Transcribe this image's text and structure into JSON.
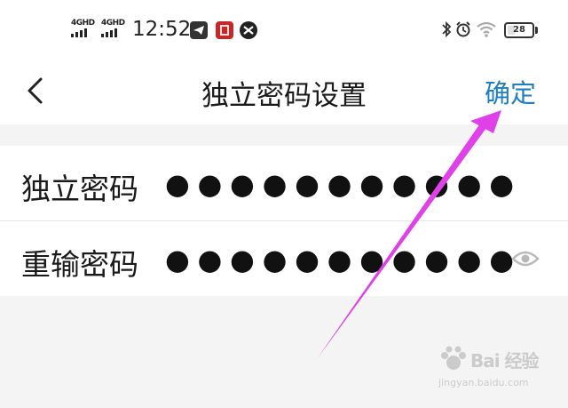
{
  "status_bar": {
    "sim1_label": "4GHD",
    "sim2_label": "4GHD",
    "time": "12:52",
    "battery_level": "28",
    "icons": [
      "telegram-icon",
      "red-app-icon",
      "capcut-icon",
      "bluetooth-icon",
      "alarm-icon",
      "wifi-icon",
      "battery-icon"
    ]
  },
  "nav": {
    "back_icon": "chevron-left-icon",
    "title": "独立密码设置",
    "confirm_label": "确定"
  },
  "form": {
    "rows": [
      {
        "label": "独立密码",
        "value": "●●●●●●●●●●●"
      },
      {
        "label": "重输密码",
        "value": "●●●●●●●●●●●",
        "trailing_icon": "eye-icon"
      }
    ]
  },
  "watermark": {
    "brand": "Bai 经验",
    "url": "jingyan.baidu.com"
  },
  "annotation": {
    "color": "#e040e8",
    "target": "confirm-button"
  }
}
